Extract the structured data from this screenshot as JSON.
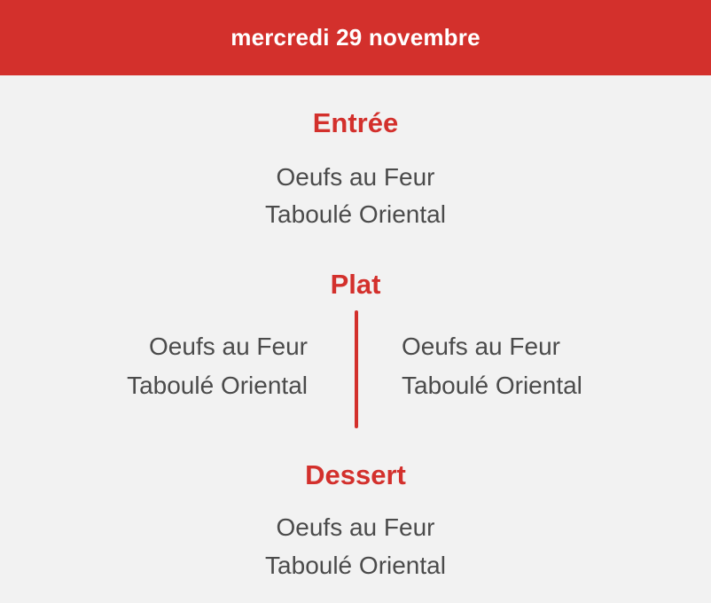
{
  "header": {
    "date": "mercredi 29 novembre"
  },
  "entree": {
    "title": "Entrée",
    "items": [
      "Oeufs au Feur",
      "Taboulé Oriental"
    ]
  },
  "plat": {
    "title": "Plat",
    "left_items": [
      "Oeufs au Feur",
      "Taboulé Oriental"
    ],
    "right_items": [
      "Oeufs au Feur",
      "Taboulé Oriental"
    ]
  },
  "dessert": {
    "title": "Dessert",
    "items": [
      "Oeufs au Feur",
      "Taboulé Oriental"
    ]
  },
  "colors": {
    "accent": "#d3302c",
    "background": "#f2f2f2",
    "text": "#4b4b4b"
  }
}
